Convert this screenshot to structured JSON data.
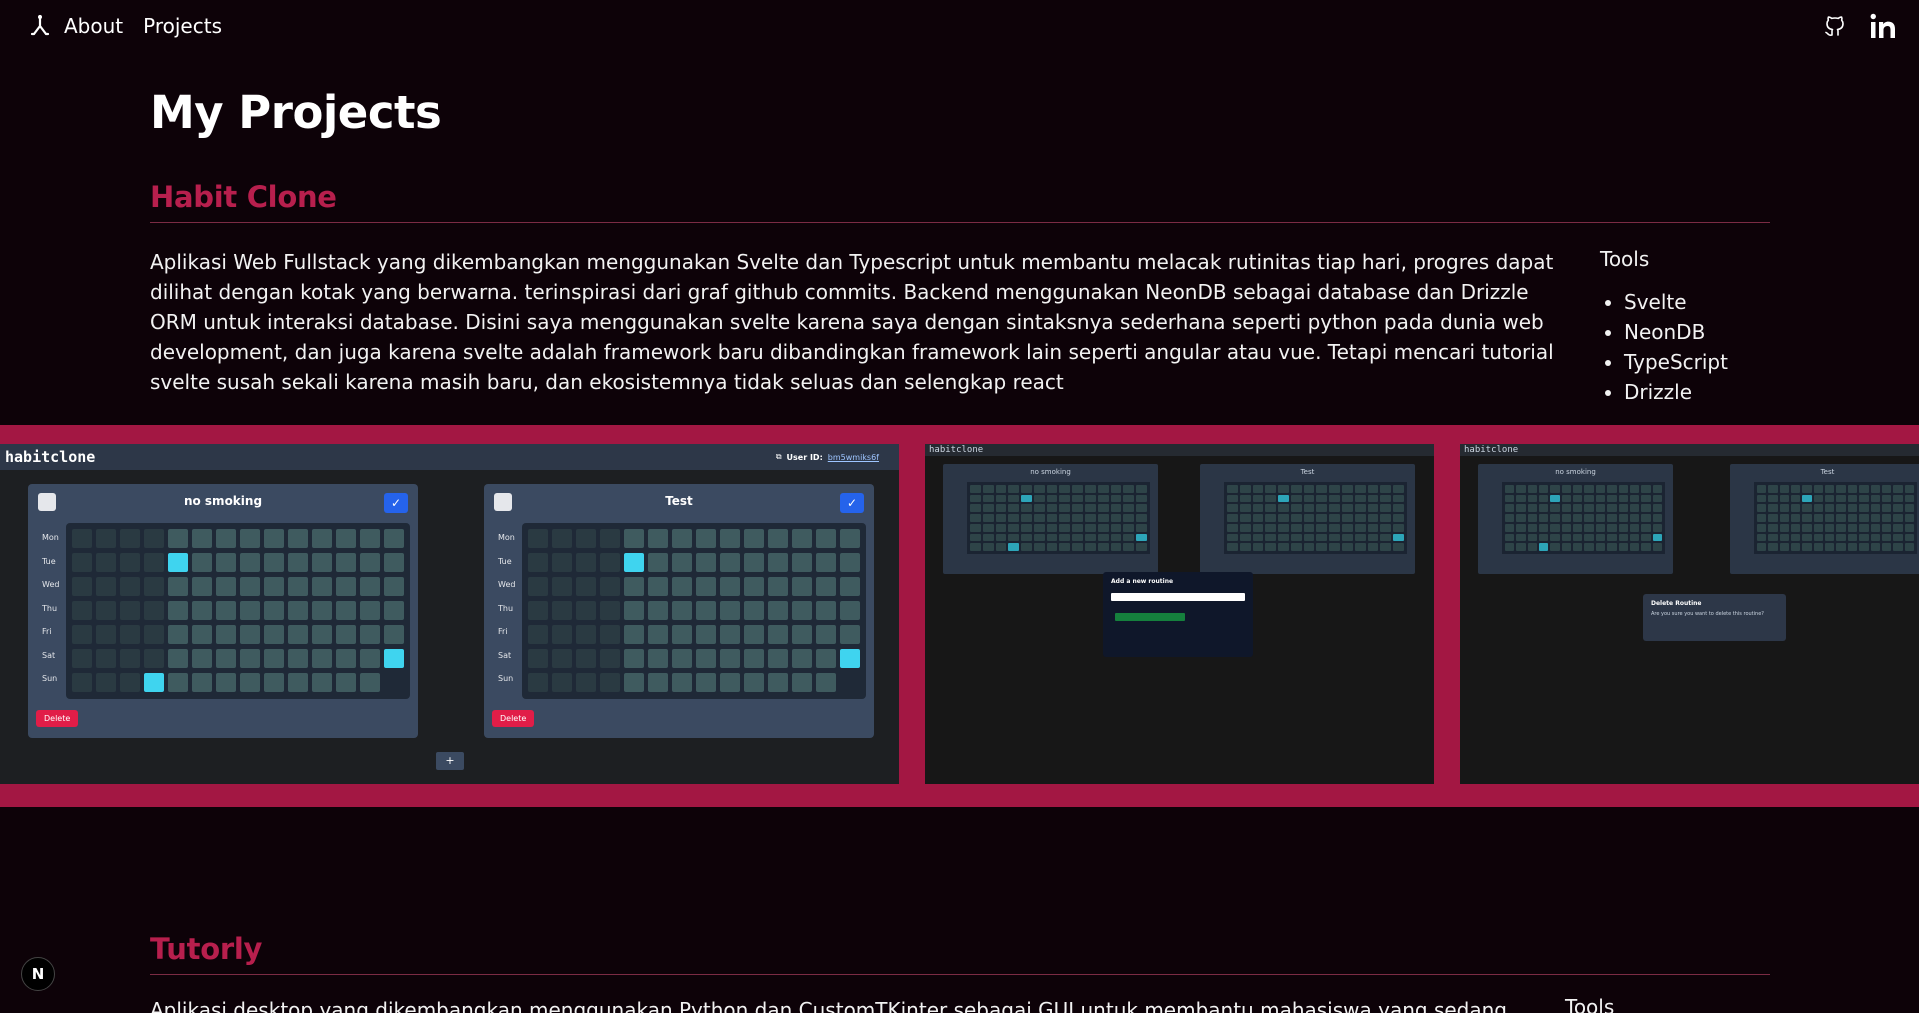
{
  "nav": {
    "about": "About",
    "projects": "Projects"
  },
  "social": {
    "github": "github-icon",
    "linkedin": "linkedin-icon"
  },
  "page_title": "My Projects",
  "projects": [
    {
      "title": "Habit Clone",
      "description": "Aplikasi Web Fullstack yang dikembangkan menggunakan Svelte dan Typescript untuk membantu melacak rutinitas tiap hari, progres dapat dilihat dengan kotak yang berwarna. terinspirasi dari graf github commits. Backend menggunakan NeonDB sebagai database dan Drizzle ORM untuk interaksi database. Disini saya menggunakan svelte karena saya dengan sintaksnya sederhana seperti python pada dunia web development, dan juga karena svelte adalah framework baru dibandingkan framework lain seperti angular atau vue. Tetapi mencari tutorial svelte susah sekali karena masih baru, dan ekosistemnya tidak seluas dan selengkap react",
      "tools_title": "Tools",
      "tools": [
        "Svelte",
        "NeonDB",
        "TypeScript",
        "Drizzle"
      ],
      "screenshots": {
        "app_name": "habitclone",
        "user_id_label": "User ID:",
        "user_id_value": "bm5wmiks6f",
        "days": [
          "Mon",
          "Tue",
          "Wed",
          "Thu",
          "Fri",
          "Sat",
          "Sun"
        ],
        "card1_title": "no smoking",
        "card2_title": "Test",
        "delete_label": "Delete",
        "add_label": "+",
        "modal_add_title": "Add a new routine",
        "modal_delete_title": "Delete Routine",
        "modal_delete_text": "Are you sure you want to delete this routine?"
      }
    },
    {
      "title": "Tutorly",
      "description": "Aplikasi desktop yang dikembangkan menggunakan Python dan CustomTKinter sebagai GUI untuk membantu mahasiswa yang sedang kesulitan",
      "tools_title": "Tools"
    }
  ],
  "fab_label": "N",
  "colors": {
    "background": "#0d0208",
    "accent": "#b71f4d",
    "band": "#a31743"
  }
}
